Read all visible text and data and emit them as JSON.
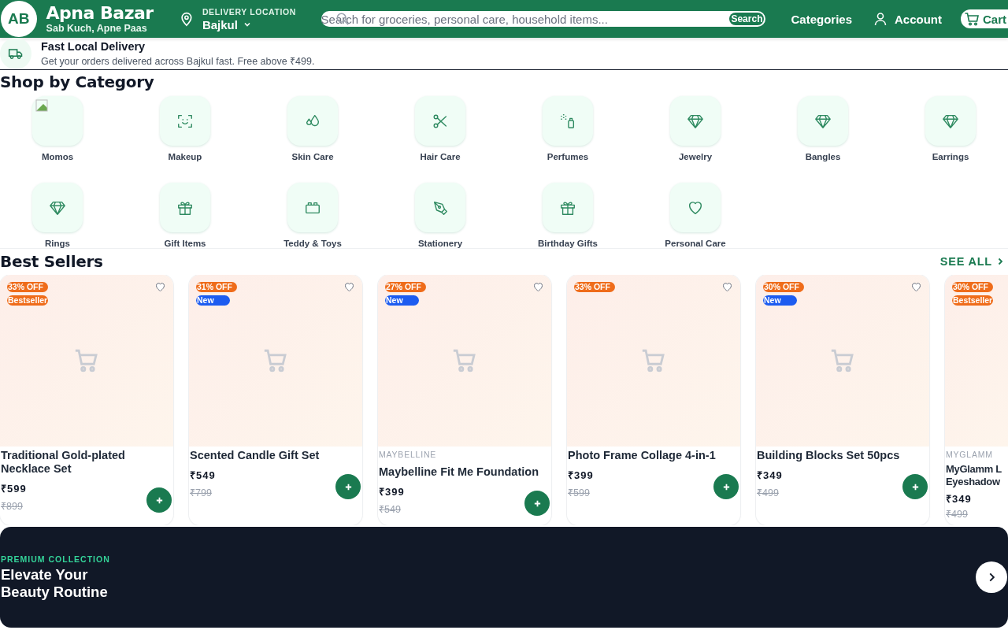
{
  "header": {
    "logo": "AB",
    "brand": "Apna Bazar",
    "tagline": "Sab Kuch, Apne Paas",
    "location_label": "DELIVERY LOCATION",
    "location": "Bajkul",
    "search": {
      "placeholder": "Search for groceries, personal care, household items...",
      "button": "Search"
    },
    "nav": [
      "Categories",
      "Account",
      "Cart"
    ]
  },
  "delivery_strip": {
    "title": "Fast Local Delivery",
    "text": "Get your orders delivered across Bajkul fast. Free above ₹499."
  },
  "categories": {
    "title": "Shop by Category",
    "items": [
      {
        "label": "Momos",
        "kind": "broken-image"
      },
      {
        "label": "Makeup",
        "kind": "face"
      },
      {
        "label": "Skin Care",
        "kind": "drops"
      },
      {
        "label": "Hair Care",
        "kind": "scissors"
      },
      {
        "label": "Perfumes",
        "kind": "spray"
      },
      {
        "label": "Jewelry",
        "kind": "gem"
      },
      {
        "label": "Bangles",
        "kind": "gem"
      },
      {
        "label": "Earrings",
        "kind": "gem"
      },
      {
        "label": "Rings",
        "kind": "gem"
      },
      {
        "label": "Gift Items",
        "kind": "gift"
      },
      {
        "label": "Teddy & Toys",
        "kind": "blocks"
      },
      {
        "label": "Stationery",
        "kind": "pen"
      },
      {
        "label": "Birthday Gifts",
        "kind": "gift"
      },
      {
        "label": "Personal Care",
        "kind": "heart"
      }
    ]
  },
  "best_sellers": {
    "title": "Best Sellers",
    "see_all": "SEE ALL",
    "products": [
      {
        "tags": [
          {
            "kind": "discount",
            "text": "33% OFF"
          },
          {
            "kind": "bestseller",
            "text": "Bestseller"
          }
        ],
        "name": "Traditional Gold-plated Necklace Set",
        "price": "₹599",
        "mrp": "₹899",
        "clipped": false
      },
      {
        "tags": [
          {
            "kind": "discount",
            "text": "31% OFF"
          },
          {
            "kind": "new",
            "text": "New"
          }
        ],
        "name": "Scented Candle Gift Set",
        "price": "₹549",
        "mrp": "₹799",
        "clipped": false
      },
      {
        "tags": [
          {
            "kind": "discount",
            "text": "27% OFF"
          },
          {
            "kind": "new",
            "text": "New"
          }
        ],
        "brand": "MAYBELLINE",
        "name": "Maybelline Fit Me Foundation",
        "price": "₹399",
        "mrp": "₹549",
        "clipped": false
      },
      {
        "tags": [
          {
            "kind": "discount",
            "text": "33% OFF"
          }
        ],
        "name": "Photo Frame Collage 4-in-1",
        "price": "₹399",
        "mrp": "₹599",
        "clipped": false
      },
      {
        "tags": [
          {
            "kind": "discount",
            "text": "30% OFF"
          },
          {
            "kind": "new",
            "text": "New"
          }
        ],
        "name": "Building Blocks Set 50pcs",
        "price": "₹349",
        "mrp": "₹499",
        "clipped": false
      },
      {
        "tags": [
          {
            "kind": "discount",
            "text": "30% OFF"
          },
          {
            "kind": "bestseller",
            "text": "Bestseller"
          }
        ],
        "brand": "MYGLAMM",
        "name": "MyGlamm L Eyeshadow",
        "price": "₹349",
        "mrp": "₹499",
        "clipped": true
      }
    ]
  },
  "banner": {
    "eyebrow": "PREMIUM COLLECTION",
    "title": "Elevate Your Beauty Routine"
  }
}
